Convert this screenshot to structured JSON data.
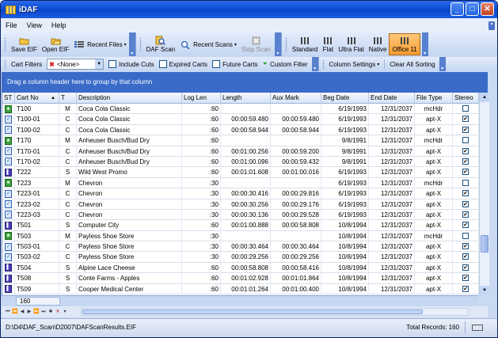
{
  "app": {
    "title": "iDAF"
  },
  "menu": [
    "File",
    "View",
    "Help"
  ],
  "toolbar": {
    "save_eif": "Save EIF",
    "open_eif": "Open EIF",
    "recent_files": "Recent Files",
    "daf_scan": "DAF Scan",
    "recent_scans": "Recent Scans",
    "stop_scan": "Stop Scan",
    "themes": [
      "Standard",
      "Flat",
      "Ultra Flat",
      "Native",
      "Office 11"
    ],
    "active_theme": "Office 11"
  },
  "filters": {
    "cart_filters_label": "Cart Filters",
    "cart_filter_value": "<None>",
    "include_cuts": "Include Cuts",
    "expired_carts": "Expired Carts",
    "future_carts": "Future Carts",
    "custom_filter": "Custom Filter",
    "column_settings": "Column Settings",
    "clear_all_sorting": "Clear All Sorting"
  },
  "grid": {
    "group_hint": "Drag a column header here to group by that column",
    "columns": [
      "ST",
      "Cart No",
      "T",
      "Description",
      "Log Len",
      "Length",
      "Aux Mark",
      "Beg Date",
      "End Date",
      "File Type",
      "Stereo"
    ],
    "rows": [
      {
        "st": "M",
        "cart": "T100",
        "t": "M",
        "desc": "Coca Cola Classic",
        "loglen": ":60",
        "length": "",
        "aux": "",
        "beg": "6/19/1993",
        "end": "12/31/2037",
        "ftype": "mcHdr",
        "stereo": false
      },
      {
        "st": "C",
        "cart": "T100-01",
        "t": "C",
        "desc": "Coca Cola Classic",
        "loglen": ":60",
        "length": "00:00:59.480",
        "aux": "00:00:59.480",
        "beg": "6/19/1993",
        "end": "12/31/2037",
        "ftype": "apt-X",
        "stereo": true
      },
      {
        "st": "C",
        "cart": "T100-02",
        "t": "C",
        "desc": "Coca Cola Classic",
        "loglen": ":60",
        "length": "00:00:58.944",
        "aux": "00:00:58.944",
        "beg": "6/19/1993",
        "end": "12/31/2037",
        "ftype": "apt-X",
        "stereo": true
      },
      {
        "st": "M",
        "cart": "T170",
        "t": "M",
        "desc": "Anheuser Busch/Bud Dry",
        "loglen": ":60",
        "length": "",
        "aux": "",
        "beg": "9/8/1991",
        "end": "12/31/2037",
        "ftype": "mcHdr",
        "stereo": false
      },
      {
        "st": "C",
        "cart": "T170-01",
        "t": "C",
        "desc": "Anheuser Busch/Bud Dry",
        "loglen": ":60",
        "length": "00:01:00.256",
        "aux": "00:00:59.200",
        "beg": "9/8/1991",
        "end": "12/31/2037",
        "ftype": "apt-X",
        "stereo": true
      },
      {
        "st": "C",
        "cart": "T170-02",
        "t": "C",
        "desc": "Anheuser Busch/Bud Dry",
        "loglen": ":60",
        "length": "00:01:00.096",
        "aux": "00:00:59.432",
        "beg": "9/8/1991",
        "end": "12/31/2037",
        "ftype": "apt-X",
        "stereo": true
      },
      {
        "st": "S",
        "cart": "T222",
        "t": "S",
        "desc": "Wild West Promo",
        "loglen": ":60",
        "length": "00:01:01.608",
        "aux": "00:01:00.016",
        "beg": "6/19/1993",
        "end": "12/31/2037",
        "ftype": "apt-X",
        "stereo": true
      },
      {
        "st": "M",
        "cart": "T223",
        "t": "M",
        "desc": "Chevron",
        "loglen": ":30",
        "length": "",
        "aux": "",
        "beg": "6/19/1993",
        "end": "12/31/2037",
        "ftype": "mcHdr",
        "stereo": false
      },
      {
        "st": "C",
        "cart": "T223-01",
        "t": "C",
        "desc": "Chevron",
        "loglen": ":30",
        "length": "00:00:30.416",
        "aux": "00:00:29.816",
        "beg": "6/19/1993",
        "end": "12/31/2037",
        "ftype": "apt-X",
        "stereo": true
      },
      {
        "st": "C",
        "cart": "T223-02",
        "t": "C",
        "desc": "Chevron",
        "loglen": ":30",
        "length": "00:00:30.256",
        "aux": "00:00:29.176",
        "beg": "6/19/1993",
        "end": "12/31/2037",
        "ftype": "apt-X",
        "stereo": true
      },
      {
        "st": "C",
        "cart": "T223-03",
        "t": "C",
        "desc": "Chevron",
        "loglen": ":30",
        "length": "00:00:30.136",
        "aux": "00:00:29.528",
        "beg": "6/19/1993",
        "end": "12/31/2037",
        "ftype": "apt-X",
        "stereo": true
      },
      {
        "st": "S",
        "cart": "T501",
        "t": "S",
        "desc": "Computer City",
        "loglen": ":60",
        "length": "00:01:00.888",
        "aux": "00:00:58.808",
        "beg": "10/8/1994",
        "end": "12/31/2037",
        "ftype": "apt-X",
        "stereo": true
      },
      {
        "st": "M",
        "cart": "T503",
        "t": "M",
        "desc": "Payless Shoe Store",
        "loglen": ":30",
        "length": "",
        "aux": "",
        "beg": "10/8/1994",
        "end": "12/31/2037",
        "ftype": "mcHdr",
        "stereo": false
      },
      {
        "st": "C",
        "cart": "T503-01",
        "t": "C",
        "desc": "Payless Shoe Store",
        "loglen": ":30",
        "length": "00:00:30.464",
        "aux": "00:00:30.464",
        "beg": "10/8/1994",
        "end": "12/31/2037",
        "ftype": "apt-X",
        "stereo": true
      },
      {
        "st": "C",
        "cart": "T503-02",
        "t": "C",
        "desc": "Payless Shoe Store",
        "loglen": ":30",
        "length": "00:00:29.256",
        "aux": "00:00:29.256",
        "beg": "10/8/1994",
        "end": "12/31/2037",
        "ftype": "apt-X",
        "stereo": true
      },
      {
        "st": "S",
        "cart": "T504",
        "t": "S",
        "desc": "Alpine Lace Cheese",
        "loglen": ":60",
        "length": "00:00:58.808",
        "aux": "00:00:58.416",
        "beg": "10/8/1994",
        "end": "12/31/2037",
        "ftype": "apt-X",
        "stereo": true
      },
      {
        "st": "S",
        "cart": "T508",
        "t": "S",
        "desc": "Conte Farms - Apples",
        "loglen": ":60",
        "length": "00:01:02.928",
        "aux": "00:01:01.864",
        "beg": "10/8/1994",
        "end": "12/31/2037",
        "ftype": "apt-X",
        "stereo": true
      },
      {
        "st": "S",
        "cart": "T509",
        "t": "S",
        "desc": "Cooper Medical Center",
        "loglen": ":60",
        "length": "00:01:01.264",
        "aux": "00:01:00.400",
        "beg": "10/8/1994",
        "end": "12/31/2037",
        "ftype": "apt-X",
        "stereo": true
      }
    ],
    "footer_count": "160"
  },
  "status": {
    "path": "D:\\D4\\DAF_Scan\\D2007\\DAFScanResults.EIF",
    "total": "Total Records: 160"
  }
}
